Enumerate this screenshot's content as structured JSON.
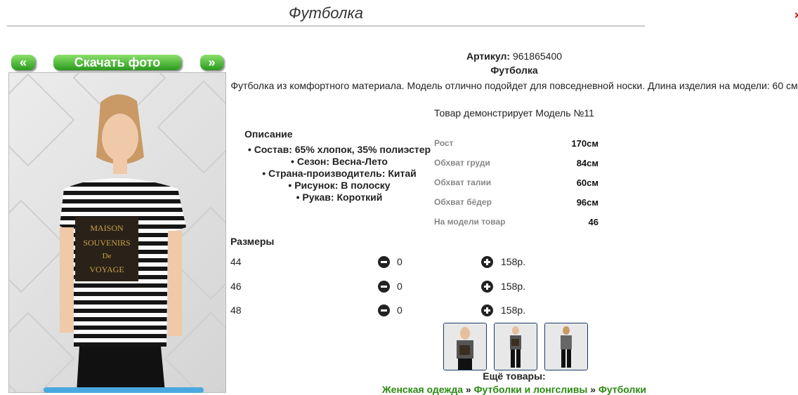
{
  "header": {
    "title": "Футболка",
    "close_glyph": "×"
  },
  "gallery": {
    "prev_label": "«",
    "next_label": "»",
    "download_label": "Скачать фото"
  },
  "product": {
    "article_label": "Артикул:",
    "article_value": "961865400",
    "name": "Футболка",
    "description": "Футболка из комфортного материала. Модель отлично подойдет для повседневной носки. Длина изделия на модели: 60 см",
    "model_demo": "Товар демонстрирует Модель №11"
  },
  "description_block": {
    "title": "Описание",
    "items": [
      "Состав: 65% хлопок, 35% полиэстер",
      "Сезон: Весна-Лето",
      "Страна-производитель: Китай",
      "Рисунок: В полоску",
      "Рукав: Короткий"
    ]
  },
  "measurements": [
    {
      "label": "Рост",
      "value": "170см"
    },
    {
      "label": "Обхват груди",
      "value": "84см"
    },
    {
      "label": "Обхват талии",
      "value": "60см"
    },
    {
      "label": "Обхват бёдер",
      "value": "96см"
    },
    {
      "label": "На модели товар",
      "value": "46"
    }
  ],
  "sizes": {
    "title": "Размеры",
    "rows": [
      {
        "size": "44",
        "qty": "0",
        "price": "158р."
      },
      {
        "size": "46",
        "qty": "0",
        "price": "158р."
      },
      {
        "size": "48",
        "qty": "0",
        "price": "158р."
      }
    ]
  },
  "more": {
    "label": "Ещё товары:",
    "crumbs": [
      "Женская одежда",
      "Футболки и лонгсливы",
      "Футболки"
    ],
    "separator": "»"
  },
  "colors": {
    "accent_green": "#2a9a1e",
    "link_green": "#2a8a10",
    "close_red": "#cc0000"
  }
}
